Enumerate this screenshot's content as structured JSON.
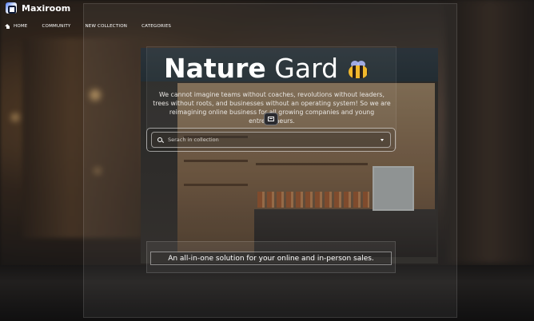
{
  "header": {
    "brand": "Maxiroom",
    "nav": [
      "HOME",
      "COMMUNITY",
      "NEW COLLECTION",
      "CATEGORIES"
    ]
  },
  "hero": {
    "title_bold": "Nature",
    "title_rest": "Gard",
    "description": "We cannot imagine teams without coaches, revolutions without leaders, trees without roots, and businesses without an operating system! So we are reimagining online business for all growing companies and young entrepreneurs."
  },
  "search": {
    "placeholder": "Serach in collection"
  },
  "footer": {
    "tagline": "An all-in-one solution for your online and in-person sales."
  }
}
